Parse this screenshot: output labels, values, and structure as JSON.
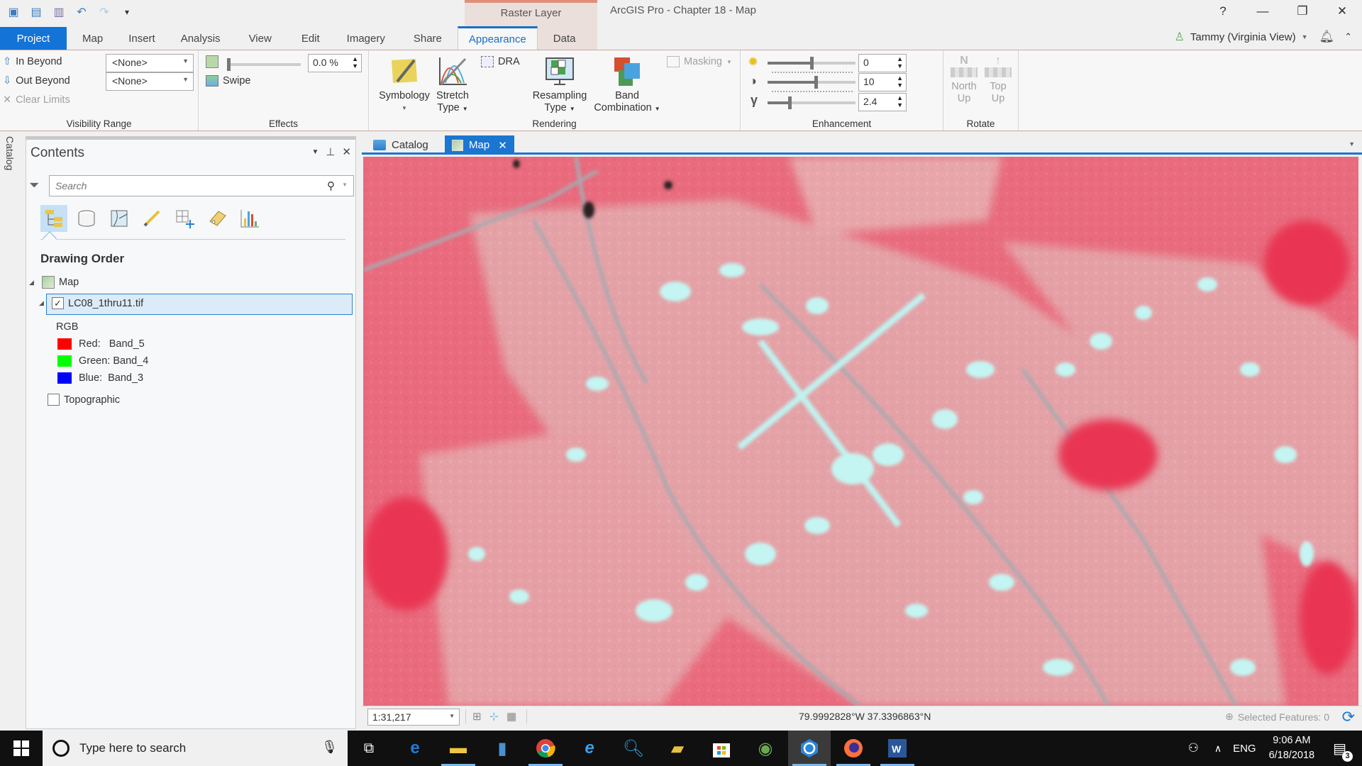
{
  "app": {
    "title": "ArcGIS Pro - Chapter 18 - Map",
    "contextual_tab_group": "Raster Layer",
    "window_controls": {
      "help": "?",
      "minimize": "—",
      "restore": "❐",
      "close": "✕"
    }
  },
  "quick_access": [
    {
      "name": "new-project-icon",
      "glyph": "🗂"
    },
    {
      "name": "open-project-icon",
      "glyph": "📂"
    },
    {
      "name": "save-project-icon",
      "glyph": "💾"
    },
    {
      "name": "undo-icon",
      "glyph": "↶"
    },
    {
      "name": "redo-icon",
      "glyph": "↷"
    },
    {
      "name": "customize-qat-icon",
      "glyph": "⩡"
    }
  ],
  "tabs": [
    {
      "label": "Project"
    },
    {
      "label": "Map"
    },
    {
      "label": "Insert"
    },
    {
      "label": "Analysis"
    },
    {
      "label": "View"
    },
    {
      "label": "Edit"
    },
    {
      "label": "Imagery"
    },
    {
      "label": "Share"
    },
    {
      "label": "Appearance",
      "active": true
    },
    {
      "label": "Data"
    }
  ],
  "user": {
    "name": "Tammy (Virginia View)"
  },
  "ribbon": {
    "visibility_range": {
      "label": "Visibility Range",
      "in_beyond": "In Beyond",
      "out_beyond": "Out Beyond",
      "clear_limits": "Clear Limits",
      "in_beyond_value": "<None>",
      "out_beyond_value": "<None>"
    },
    "effects": {
      "label": "Effects",
      "transparency_value": "0.0 %",
      "transparency_percent": 0,
      "swipe": "Swipe"
    },
    "rendering": {
      "label": "Rendering",
      "symbology": "Symbology",
      "stretch_type": [
        "Stretch",
        "Type"
      ],
      "dra": "DRA",
      "resampling_type": [
        "Resampling",
        "Type"
      ],
      "band_combination": [
        "Band",
        "Combination"
      ],
      "masking": "Masking"
    },
    "enhancement": {
      "label": "Enhancement",
      "brightness": "0",
      "contrast": "10",
      "gamma": "2.4",
      "brightness_slider_fraction": 0.5,
      "contrast_slider_fraction": 0.55,
      "gamma_slider_fraction": 0.25
    },
    "rotate": {
      "label": "Rotate",
      "north_up": [
        "North",
        "Up"
      ],
      "top_up": [
        "Top",
        "Up"
      ]
    }
  },
  "catalog_strip": "Catalog",
  "contents": {
    "title": "Contents",
    "search_placeholder": "Search",
    "section": "Drawing Order",
    "map_node": "Map",
    "layer": "LC08_1thru11.tif",
    "renderer": "RGB",
    "bands": [
      {
        "label": "Red:   Band_5",
        "color": "#ff0000"
      },
      {
        "label": "Green: Band_4",
        "color": "#00ff00"
      },
      {
        "label": "Blue:  Band_3",
        "color": "#0000ff"
      }
    ],
    "basemap": "Topographic"
  },
  "map_view": {
    "tabs": [
      {
        "label": "Catalog"
      },
      {
        "label": "Map",
        "active": true
      }
    ],
    "scale": "1:31,217",
    "coordinates": "79.9992828°W 37.3396863°N",
    "selected_features": "Selected Features: 0"
  },
  "taskbar": {
    "search_placeholder": "Type here to search",
    "language": "ENG",
    "time": "9:06 AM",
    "date": "6/18/2018",
    "notifications": "3"
  },
  "colors": {
    "accent": "#1b76d2",
    "project_tab": "#1373d6",
    "context_band": "#ebdfdb",
    "vegetation_red": "#e8455e",
    "urban_cyan": "#b9f0ee"
  }
}
